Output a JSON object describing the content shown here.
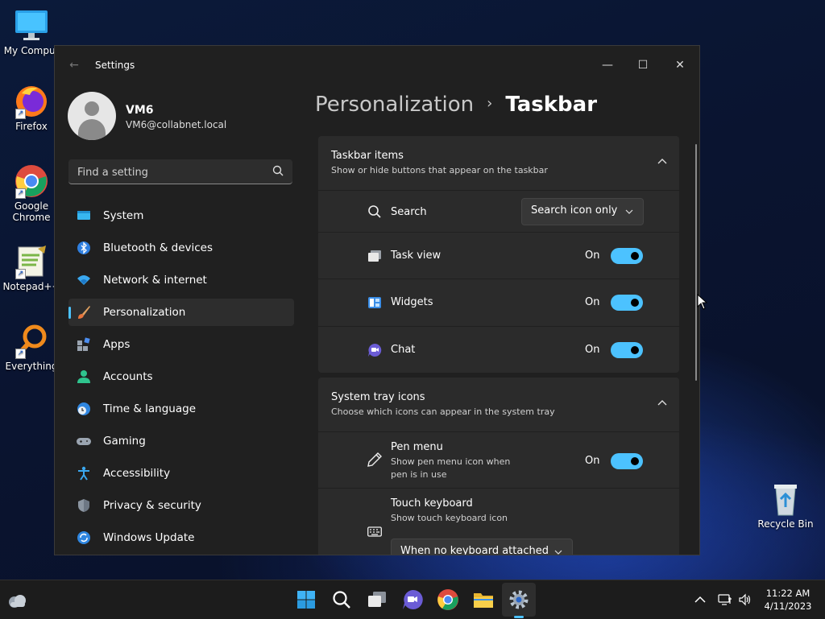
{
  "desktop": {
    "icons": [
      {
        "label": "My Comput"
      },
      {
        "label": "Firefox"
      },
      {
        "label": "Google Chrome"
      },
      {
        "label": "Notepad++"
      },
      {
        "label": "Everything"
      },
      {
        "label": "Recycle Bin"
      }
    ]
  },
  "window": {
    "title": "Settings",
    "controls": {
      "minimize": "—",
      "maximize": "☐",
      "close": "✕"
    },
    "back_icon": "←"
  },
  "user": {
    "name": "VM6",
    "email": "VM6@collabnet.local"
  },
  "search": {
    "placeholder": "Find a setting",
    "value": ""
  },
  "nav": {
    "items": [
      {
        "label": "System",
        "icon": "system-icon"
      },
      {
        "label": "Bluetooth & devices",
        "icon": "bluetooth-icon"
      },
      {
        "label": "Network & internet",
        "icon": "wifi-icon"
      },
      {
        "label": "Personalization",
        "icon": "brush-icon",
        "active": true
      },
      {
        "label": "Apps",
        "icon": "apps-icon"
      },
      {
        "label": "Accounts",
        "icon": "accounts-icon"
      },
      {
        "label": "Time & language",
        "icon": "clock-globe-icon"
      },
      {
        "label": "Gaming",
        "icon": "gamepad-icon"
      },
      {
        "label": "Accessibility",
        "icon": "accessibility-icon"
      },
      {
        "label": "Privacy & security",
        "icon": "shield-icon"
      },
      {
        "label": "Windows Update",
        "icon": "update-icon"
      }
    ]
  },
  "breadcrumb": {
    "parent": "Personalization",
    "separator": "›",
    "current": "Taskbar"
  },
  "sections": {
    "taskbar_items": {
      "title": "Taskbar items",
      "subtitle": "Show or hide buttons that appear on the taskbar",
      "rows": {
        "search": {
          "label": "Search",
          "dropdown_value": "Search icon only"
        },
        "task_view": {
          "label": "Task view",
          "state": "On"
        },
        "widgets": {
          "label": "Widgets",
          "state": "On"
        },
        "chat": {
          "label": "Chat",
          "state": "On"
        }
      }
    },
    "system_tray": {
      "title": "System tray icons",
      "subtitle": "Choose which icons can appear in the system tray",
      "rows": {
        "pen_menu": {
          "label": "Pen menu",
          "description": "Show pen menu icon when pen is in use",
          "state": "On"
        },
        "touch_keyboard": {
          "label": "Touch keyboard",
          "description": "Show touch keyboard icon",
          "dropdown_value": "When no keyboard attached"
        }
      }
    }
  },
  "taskbar": {
    "clock": {
      "time": "11:22 AM",
      "date": "4/11/2023"
    }
  },
  "colors": {
    "accent": "#4cc2ff",
    "window_bg": "#202020",
    "card_bg": "#2b2b2b"
  }
}
